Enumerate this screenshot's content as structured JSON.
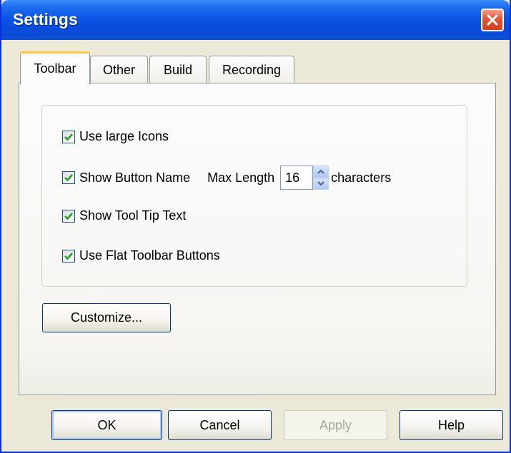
{
  "window": {
    "title": "Settings"
  },
  "tabs": [
    {
      "label": "Toolbar",
      "active": true
    },
    {
      "label": "Other",
      "active": false
    },
    {
      "label": "Build",
      "active": false
    },
    {
      "label": "Recording",
      "active": false
    }
  ],
  "options": {
    "large_icons": {
      "label": "Use large Icons",
      "checked": true
    },
    "show_button_name": {
      "label": "Show Button Name",
      "checked": true
    },
    "max_length_label": "Max Length",
    "max_length_value": "16",
    "max_length_unit": "characters",
    "tool_tip": {
      "label": "Show Tool Tip Text",
      "checked": true
    },
    "flat_buttons": {
      "label": "Use Flat Toolbar Buttons",
      "checked": true
    }
  },
  "customize_label": "Customize...",
  "buttons": {
    "ok": "OK",
    "cancel": "Cancel",
    "apply": "Apply",
    "help": "Help"
  },
  "colors": {
    "title_bar": "#0a4ad8",
    "dialog_face": "#ece9d8",
    "active_tab_highlight": "#ffc83c",
    "checkmark": "#21a121",
    "close_button": "#d2401f"
  },
  "icons": {
    "close": "close-x-icon",
    "check": "checkmark-icon",
    "spin_up": "chevron-up-icon",
    "spin_down": "chevron-down-icon"
  }
}
